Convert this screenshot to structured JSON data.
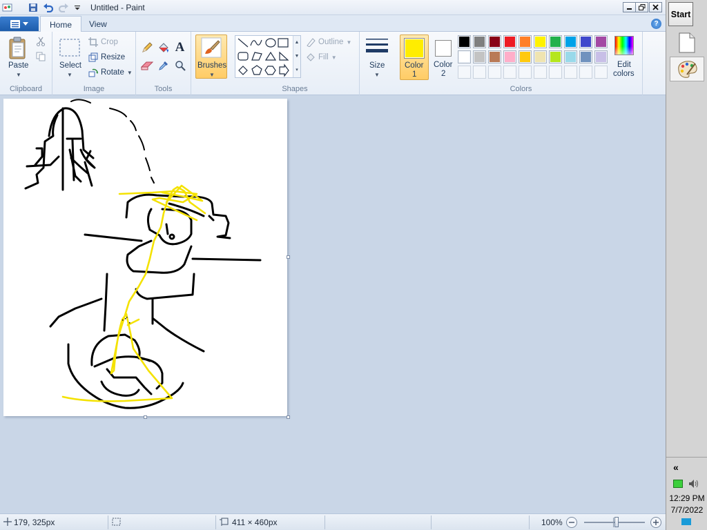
{
  "window": {
    "title": "Untitled - Paint"
  },
  "quick_access": [
    "paint-app-icon",
    "save-icon",
    "undo-icon",
    "redo-icon",
    "customize-dropdown-icon"
  ],
  "tabs": [
    {
      "label": "Home",
      "active": true
    },
    {
      "label": "View",
      "active": false
    }
  ],
  "ribbon": {
    "clipboard": {
      "group_label": "Clipboard",
      "paste_label": "Paste"
    },
    "image": {
      "group_label": "Image",
      "select_label": "Select",
      "crop_label": "Crop",
      "resize_label": "Resize",
      "rotate_label": "Rotate"
    },
    "tools": {
      "group_label": "Tools"
    },
    "brushes": {
      "label": "Brushes"
    },
    "shapes": {
      "group_label": "Shapes",
      "outline_label": "Outline",
      "fill_label": "Fill"
    },
    "size": {
      "label": "Size"
    },
    "color1": {
      "label_line1": "Color",
      "label_line2": "1",
      "value": "#ffed00"
    },
    "color2": {
      "label_line1": "Color",
      "label_line2": "2",
      "value": "#ffffff"
    },
    "colors": {
      "group_label": "Colors",
      "edit_line1": "Edit",
      "edit_line2": "colors",
      "row1": [
        "#000000",
        "#7f7f7f",
        "#880015",
        "#ed1c24",
        "#ff7f27",
        "#fff200",
        "#22b14c",
        "#00a2e8",
        "#3f48cc",
        "#a349a4"
      ],
      "row2": [
        "#ffffff",
        "#c3c3c3",
        "#b97a57",
        "#ffaec9",
        "#ffc90e",
        "#efe4b0",
        "#b5e61d",
        "#99d9ea",
        "#7092be",
        "#c8bfe7"
      ]
    }
  },
  "status": {
    "cursor_position": "179, 325px",
    "selection_size": "",
    "canvas_size": "411 × 460px",
    "zoom": "100%"
  },
  "taskbar": {
    "start_label": "Start",
    "collapse_label": "«",
    "time": "12:29 PM",
    "date": "7/7/2022"
  },
  "colors": {
    "accent": "#1d5cab",
    "workspace": "#c9d6e7",
    "selected_tool": "#ffc46b"
  }
}
